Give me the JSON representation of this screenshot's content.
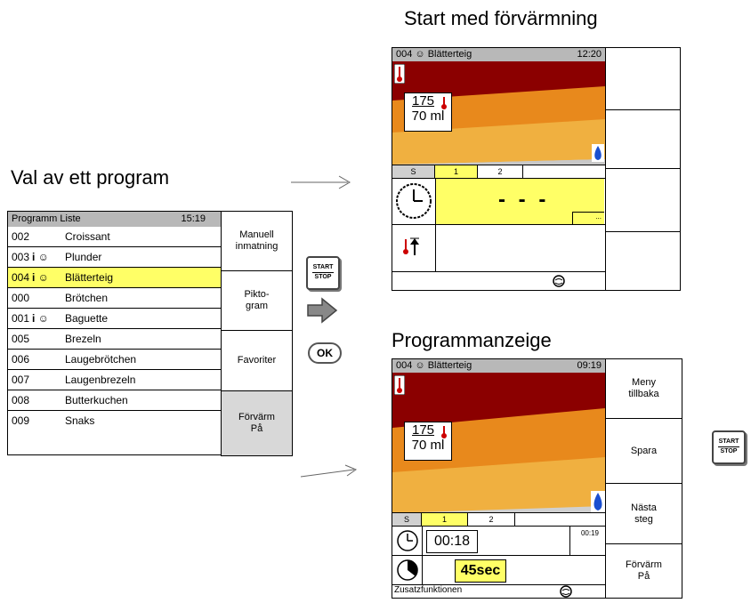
{
  "headings": {
    "left": "Val av ett program",
    "top_right": "Start med förvärmning",
    "bottom_right": "Programmanzeige"
  },
  "program_list": {
    "title": "Programm Liste",
    "time": "15:19",
    "rows": [
      {
        "num": "002",
        "name": "Croissant"
      },
      {
        "num": "003",
        "flags": "i ☺",
        "name": "Plunder"
      },
      {
        "num": "004",
        "flags": "i ☺",
        "name": "Blätterteig",
        "selected": true
      },
      {
        "num": "000",
        "name": "Brötchen"
      },
      {
        "num": "001",
        "flags": "i ☺",
        "name": "Baguette"
      },
      {
        "num": "005",
        "name": "Brezeln"
      },
      {
        "num": "006",
        "name": "Laugebrötchen"
      },
      {
        "num": "007",
        "name": "Laugenbrezeln"
      },
      {
        "num": "008",
        "name": "Butterkuchen"
      },
      {
        "num": "009",
        "name": "Snaks"
      }
    ],
    "buttons": [
      "Manuell\ninmatning",
      "Pikto-\ngram",
      "Favoriter",
      "Förvärm\nPå"
    ]
  },
  "middle_keys": {
    "start_line1": "START",
    "start_line2": "STOP",
    "ok": "OK"
  },
  "preheat_screen": {
    "program": "004 ☺  Blätterteig",
    "time": "12:20",
    "temp": "175",
    "volume": "70 ml",
    "tabs": [
      "S",
      "1",
      "2"
    ],
    "dashes": "- - -",
    "small_box": "..."
  },
  "program_screen": {
    "program": "004 ☺  Blätterteig",
    "time": "09:19",
    "temp": "175",
    "volume": "70 ml",
    "tabs": [
      "S",
      "1",
      "2"
    ],
    "duration": "00:18",
    "duration_small": "00:19",
    "steam": "45sec",
    "footer": "Zusatzfunktionen",
    "buttons": [
      "Meny\ntillbaka",
      "Spara",
      "Nästa\nsteg",
      "Förvärm\nPå"
    ]
  },
  "right_key": {
    "line1": "START",
    "line2": "STOP"
  },
  "colors": {
    "selected_row": "#ffff66",
    "titlebar": "#b8b8b8",
    "oven_dark_red": "#8b0000",
    "oven_orange": "#e8891c",
    "oven_light": "#f4b040",
    "highlight_yellow": "#ffff66"
  }
}
